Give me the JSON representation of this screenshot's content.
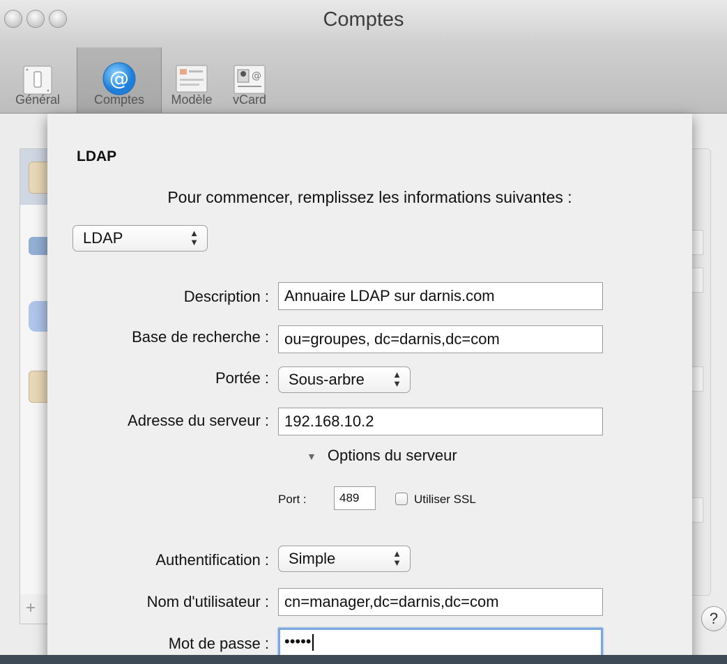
{
  "window": {
    "title": "Comptes"
  },
  "toolbar": {
    "items": [
      {
        "label": "Général"
      },
      {
        "label": "Comptes"
      },
      {
        "label": "Modèle"
      },
      {
        "label": "vCard"
      }
    ],
    "selected": "Comptes"
  },
  "sheet": {
    "title": "LDAP",
    "subtitle": "Pour commencer, remplissez les informations suivantes :",
    "account_type": "LDAP",
    "description_label": "Description :",
    "description_value": "Annuaire LDAP sur darnis.com",
    "search_base_label": "Base de recherche :",
    "search_base_value": "ou=groupes, dc=darnis,dc=com",
    "scope_label": "Portée :",
    "scope_value": "Sous-arbre",
    "server_label": "Adresse du serveur :",
    "server_value": "192.168.10.2",
    "server_options_label": "Options du serveur",
    "port_label": "Port :",
    "port_value": "489",
    "ssl_label": "Utiliser SSL",
    "ssl_checked": false,
    "auth_label": "Authentification :",
    "auth_value": "Simple",
    "username_label": "Nom d'utilisateur :",
    "username_value": "cn=manager,dc=darnis,dc=com",
    "password_label": "Mot de passe :",
    "password_value": "•••••"
  },
  "help": {
    "label": "?"
  },
  "colors": {
    "focus_ring": "#7aa7dd",
    "selected_tab": "#a7a7a7"
  }
}
